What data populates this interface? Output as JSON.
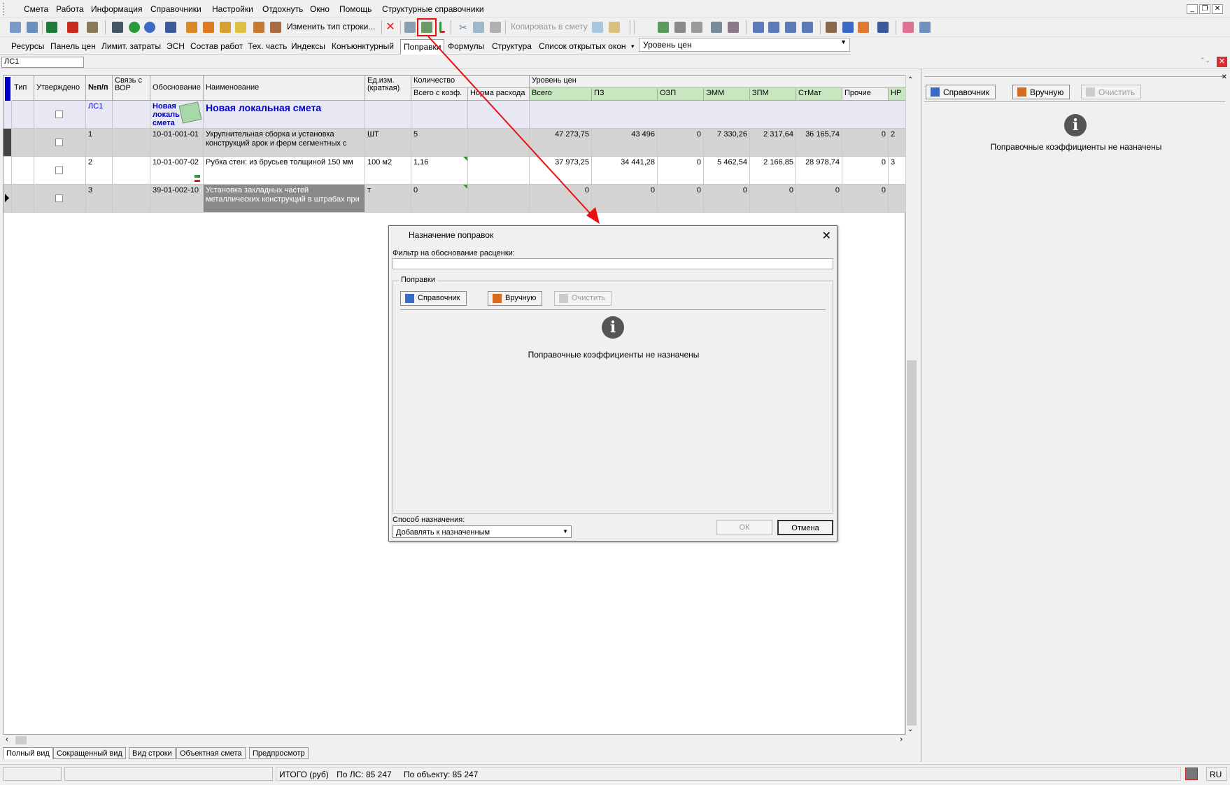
{
  "menu": {
    "items": [
      "Смета",
      "Работа",
      "Информация",
      "Справочники",
      "Настройки",
      "Отдохнуть",
      "Окно",
      "Помощь",
      "Структурные справочники"
    ]
  },
  "toolbar": {
    "change_type_label": "Изменить тип строки...",
    "copy_to_estimate_label": "Копировать в смету"
  },
  "tabs": {
    "items": [
      "Ресурсы",
      "Панель цен",
      "Лимит. затраты",
      "ЭСН",
      "Состав работ",
      "Тех. часть",
      "Индексы",
      "Конъюнктурный",
      "Поправки",
      "Формулы",
      "Структура",
      "Список открытых окон"
    ],
    "open_windows_arrow": "▾"
  },
  "price_level": {
    "value": "Уровень цен"
  },
  "address": {
    "value": "ЛС1"
  },
  "grid": {
    "headers": {
      "type": "Тип",
      "approved": "Утверждено",
      "num": "№п/п",
      "link": "Связь с ВОР",
      "basis": "Обоснование",
      "name": "Наименование",
      "unit": "Ед.изм. (краткая)",
      "quantity": "Количество",
      "qty_total": "Всего с коэф.",
      "qty_norm": "Норма расхода",
      "price_level": "Уровень цен",
      "total": "Всего",
      "pz": "ПЗ",
      "ozp": "ОЗП",
      "emm": "ЭММ",
      "zpm": "ЗПМ",
      "stmat": "СтМат",
      "other": "Прочие",
      "nr": "НР"
    },
    "section": {
      "num": "ЛС1",
      "basis": "Новая локаль смета",
      "name": "Новая локальная смета"
    },
    "rows": [
      {
        "num": "1",
        "basis": "10-01-001-01",
        "name": "Укрупнительная сборка и установка конструкций арок и ферм сегментных с",
        "unit": "ШТ",
        "qty": "5",
        "total": "47 273,75",
        "pz": "43 496",
        "ozp": "0",
        "emm": "7 330,26",
        "zpm": "2 317,64",
        "stmat": "36 165,74",
        "other": "0",
        "nr": "2"
      },
      {
        "num": "2",
        "basis": "10-01-007-02",
        "name": "Рубка стен: из брусьев толщиной 150 мм",
        "unit": "100 м2",
        "qty": "1,16",
        "total": "37 973,25",
        "pz": "34 441,28",
        "ozp": "0",
        "emm": "5 462,54",
        "zpm": "2 166,85",
        "stmat": "28 978,74",
        "other": "0",
        "nr": "3"
      },
      {
        "num": "3",
        "basis": "39-01-002-10",
        "name": "Установка закладных частей металлических конструкций в штрабах при",
        "unit": "т",
        "qty": "0",
        "total": "0",
        "pz": "0",
        "ozp": "0",
        "emm": "0",
        "zpm": "0",
        "stmat": "0",
        "other": "0",
        "nr": ""
      }
    ]
  },
  "bottom_tabs": [
    "Полный вид",
    "Сокращенный вид",
    "Вид строки",
    "Объектная смета",
    "Предпросмотр"
  ],
  "status": {
    "total": "ИТОГО (руб)",
    "by_ls": "По ЛС: 85 247",
    "by_object": "По объекту: 85 247",
    "lang": "RU"
  },
  "right_panel": {
    "directory_btn": "Справочник",
    "manual_btn": "Вручную",
    "clear_btn": "Очистить",
    "message": "Поправочные коэффициенты не назначены"
  },
  "dialog": {
    "title": "Назначение поправок",
    "filter_label": "Фильтр на обоснование расценки:",
    "group_label": "Поправки",
    "directory_btn": "Справочник",
    "manual_btn": "Вручную",
    "clear_btn": "Очистить",
    "message": "Поправочные коэффициенты не назначены",
    "method_label": "Способ назначения:",
    "method_value": "Добавлять к назначенным",
    "ok_btn": "ОК",
    "cancel_btn": "Отмена"
  },
  "colors": {
    "accent_blue": "#0000cc",
    "highlight_red": "#e81010",
    "header_green": "#c8e6c0"
  }
}
